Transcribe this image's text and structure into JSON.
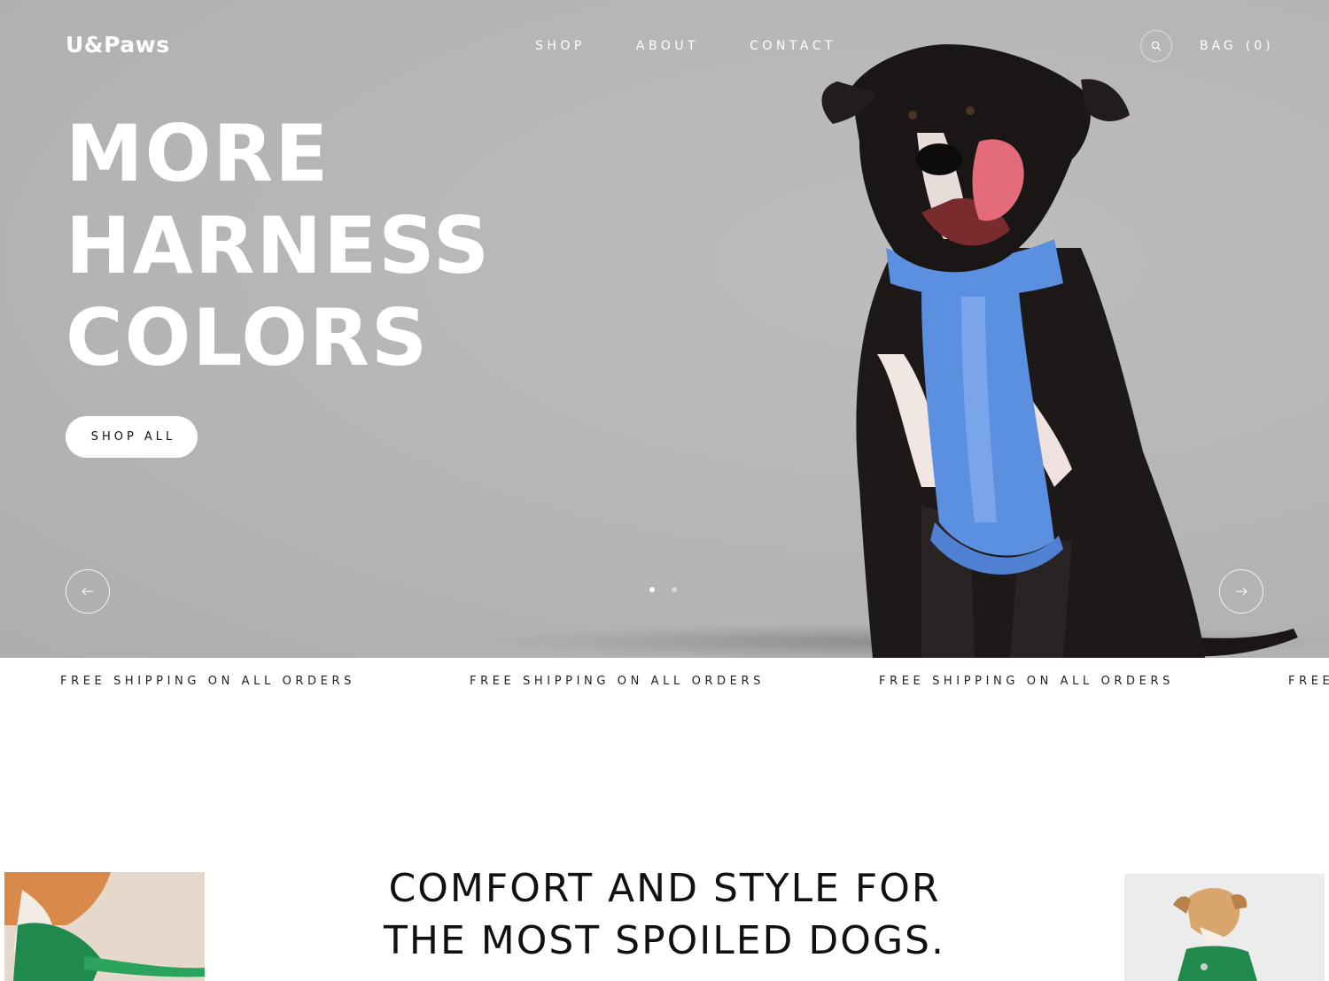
{
  "brand": {
    "logo_text": "U&Paws"
  },
  "nav": {
    "items": [
      {
        "label": "SHOP"
      },
      {
        "label": "ABOUT"
      },
      {
        "label": "CONTACT"
      }
    ]
  },
  "header": {
    "search_icon": "search-icon",
    "bag_label": "BAG",
    "bag_count": "(0)"
  },
  "hero": {
    "title_lines": [
      "MORE",
      "HARNESS",
      "COLORS"
    ],
    "cta_label": "SHOP ALL",
    "prev_icon": "arrow-left-icon",
    "next_icon": "arrow-right-icon",
    "slides_total": 2,
    "slide_active": 1,
    "background_color": "#b8b8b8",
    "harness_color": "#5b8fe0"
  },
  "marquee": {
    "items": [
      "FREE SHIPPING ON ALL ORDERS",
      "FREE SHIPPING ON ALL ORDERS",
      "FREE SHIPPING ON ALL ORDERS",
      "FREE SHIPPING ON ALL ORDERS"
    ]
  },
  "intro": {
    "title_lines": [
      "COMFORT AND STYLE FOR",
      "THE MOST SPOILED DOGS."
    ],
    "accent_color": "#1f8a4c"
  }
}
